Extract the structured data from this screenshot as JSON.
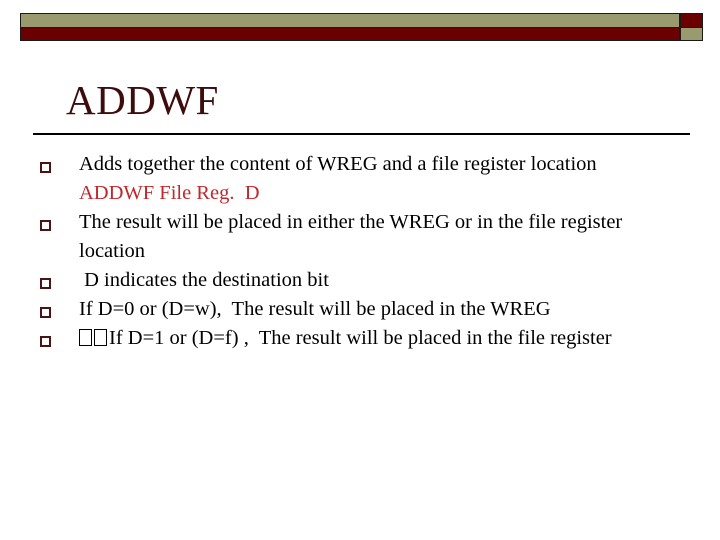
{
  "slide": {
    "title": "ADDWF",
    "banner": {
      "khaki_color": "#999a6e",
      "dark_red_color": "#6b0000",
      "outline_color": "#1a1a1a"
    },
    "title_color": "#3d0c0c",
    "rule_color": "#000000",
    "bullet_marker_color": "#4a1414",
    "accent_text_color": "#c0282d",
    "body_text_color": "#000000",
    "bullets": [
      {
        "text": "Adds together the content of WREG and a file register location",
        "accent": false,
        "sub_line": "ADDWF File Reg.  D"
      },
      {
        "text": "The result will be placed in either the WREG or in the file register location",
        "accent": false,
        "sub_line": ""
      },
      {
        "text": " D indicates the destination bit",
        "accent": false,
        "sub_line": ""
      },
      {
        "text": "If D=0 or (D=w),  The result will be placed in the WREG",
        "accent": false,
        "sub_line": ""
      },
      {
        "text": "If D=1 or (D=f) ,  The result will be placed in the file register",
        "accent": false,
        "sub_line": "",
        "leading_tofu": 2
      }
    ]
  }
}
